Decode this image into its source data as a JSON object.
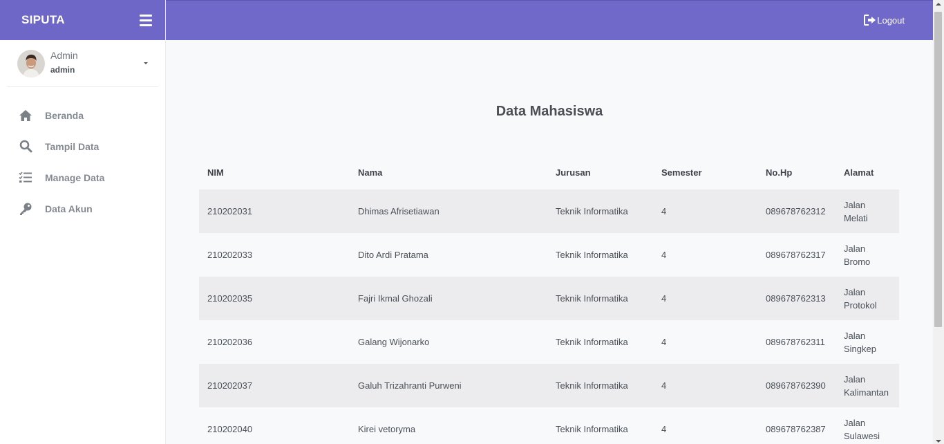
{
  "brand": {
    "name": "SIPUTA"
  },
  "user": {
    "name": "Admin",
    "role": "admin"
  },
  "nav": {
    "items": [
      {
        "label": "Beranda",
        "icon": "home-icon"
      },
      {
        "label": "Tampil Data",
        "icon": "search-icon"
      },
      {
        "label": "Manage Data",
        "icon": "list-check-icon"
      },
      {
        "label": "Data Akun",
        "icon": "key-icon"
      }
    ]
  },
  "topbar": {
    "logout_label": "Logout"
  },
  "page": {
    "title": "Data Mahasiswa"
  },
  "table": {
    "headers": [
      "NIM",
      "Nama",
      "Jurusan",
      "Semester",
      "No.Hp",
      "Alamat"
    ],
    "rows": [
      [
        "210202031",
        "Dhimas Afrisetiawan",
        "Teknik Informatika",
        "4",
        "089678762312",
        "Jalan\nMelati"
      ],
      [
        "210202033",
        "Dito Ardi Pratama",
        "Teknik Informatika",
        "4",
        "089678762317",
        "Jalan\nBromo"
      ],
      [
        "210202035",
        "Fajri Ikmal Ghozali",
        "Teknik Informatika",
        "4",
        "089678762313",
        "Jalan\nProtokol"
      ],
      [
        "210202036",
        "Galang Wijonarko",
        "Teknik Informatika",
        "4",
        "089678762311",
        "Jalan\nSingkep"
      ],
      [
        "210202037",
        "Galuh Trizahranti Purweni",
        "Teknik Informatika",
        "4",
        "089678762390",
        "Jalan\nKalimantan"
      ],
      [
        "210202040",
        "Kirei vetoryma",
        "Teknik Informatika",
        "4",
        "089678762387",
        "Jalan\nSulawesi"
      ]
    ]
  },
  "colors": {
    "header": "#7169c9",
    "brand": "#6f67c7",
    "stripe": "#ececee"
  }
}
